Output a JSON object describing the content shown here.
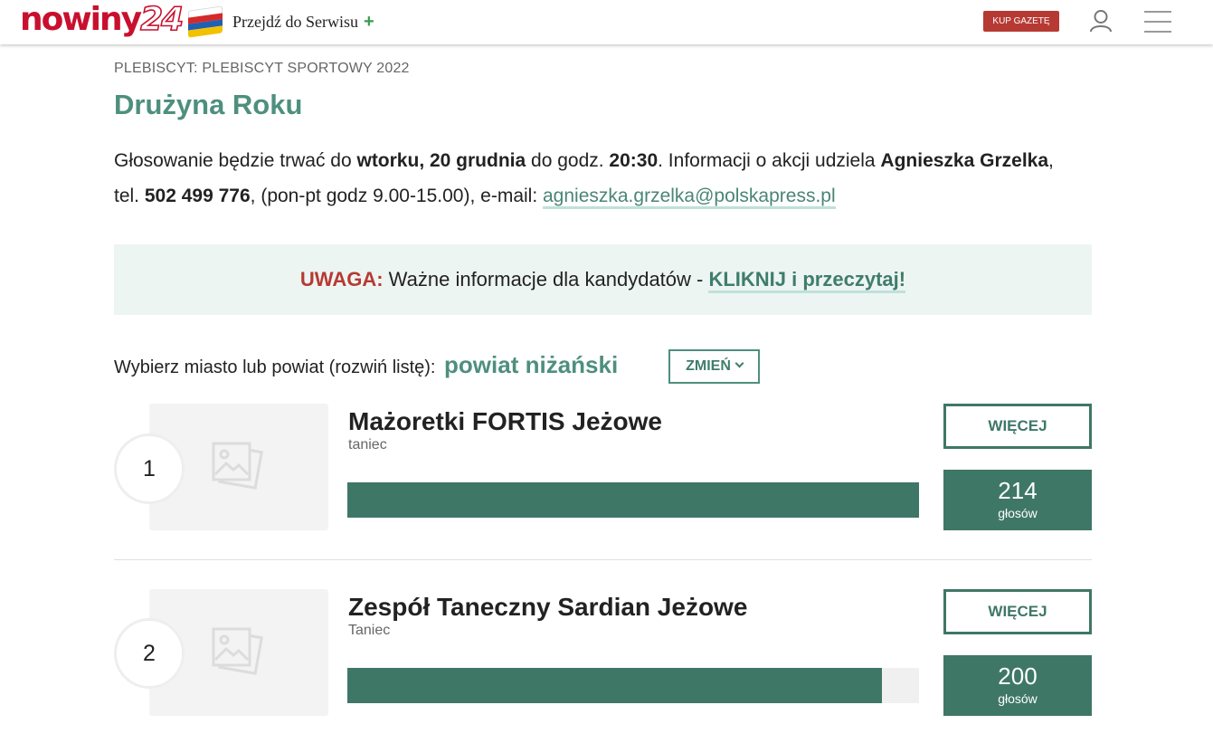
{
  "header": {
    "logo_name": "nowiny",
    "logo_number": "24",
    "goto_label": "Przejdź do Serwisu",
    "goto_plus": "+",
    "buy_label": "KUP GAZETĘ",
    "icons": [
      "flag-icon",
      "plus-icon",
      "user-icon",
      "hamburger-menu-icon"
    ]
  },
  "page": {
    "breadcrumb": "PLEBISCYT: PLEBISCYT SPORTOWY 2022",
    "title": "Drużyna Roku",
    "info": {
      "p1": "Głosowanie będzie trwać do ",
      "b1": "wtorku, 20 grudnia",
      "p2": " do godz. ",
      "b2": "20:30",
      "p3": ". Informacji o akcji udziela ",
      "b3": "Agnieszka Grzelka",
      "p4": ", tel. ",
      "b4": "502 499 776",
      "p5": ", (pon-pt godz 9.00-15.00), e-mail: ",
      "email": "agnieszka.grzelka@polskapress.pl"
    },
    "notice": {
      "warning": "UWAGA:",
      "text": " Ważne informacje dla kandydatów - ",
      "link": "KLIKNIJ i przeczytaj!"
    },
    "chooser": {
      "label": "Wybierz miasto lub powiat (rozwiń listę):",
      "selected": "powiat niżański",
      "change_button": "ZMIEŃ"
    }
  },
  "candidates": [
    {
      "rank": "1",
      "name": "Mażoretki FORTIS Jeżowe",
      "category": "taniec",
      "votes": "214",
      "votes_label": "głosów",
      "more_label": "WIĘCEJ",
      "share": 1.0
    },
    {
      "rank": "2",
      "name": "Zespół Taneczny Sardian Jeżowe",
      "category": "Taniec",
      "votes": "200",
      "votes_label": "głosów",
      "more_label": "WIĘCEJ",
      "share": 0.935
    }
  ],
  "colors": {
    "brand_red": "#c8102e",
    "accent_green": "#4e8f7e",
    "bar_green": "#3f7767",
    "warning_red": "#b63a33",
    "notice_bg": "#edf5f3"
  }
}
